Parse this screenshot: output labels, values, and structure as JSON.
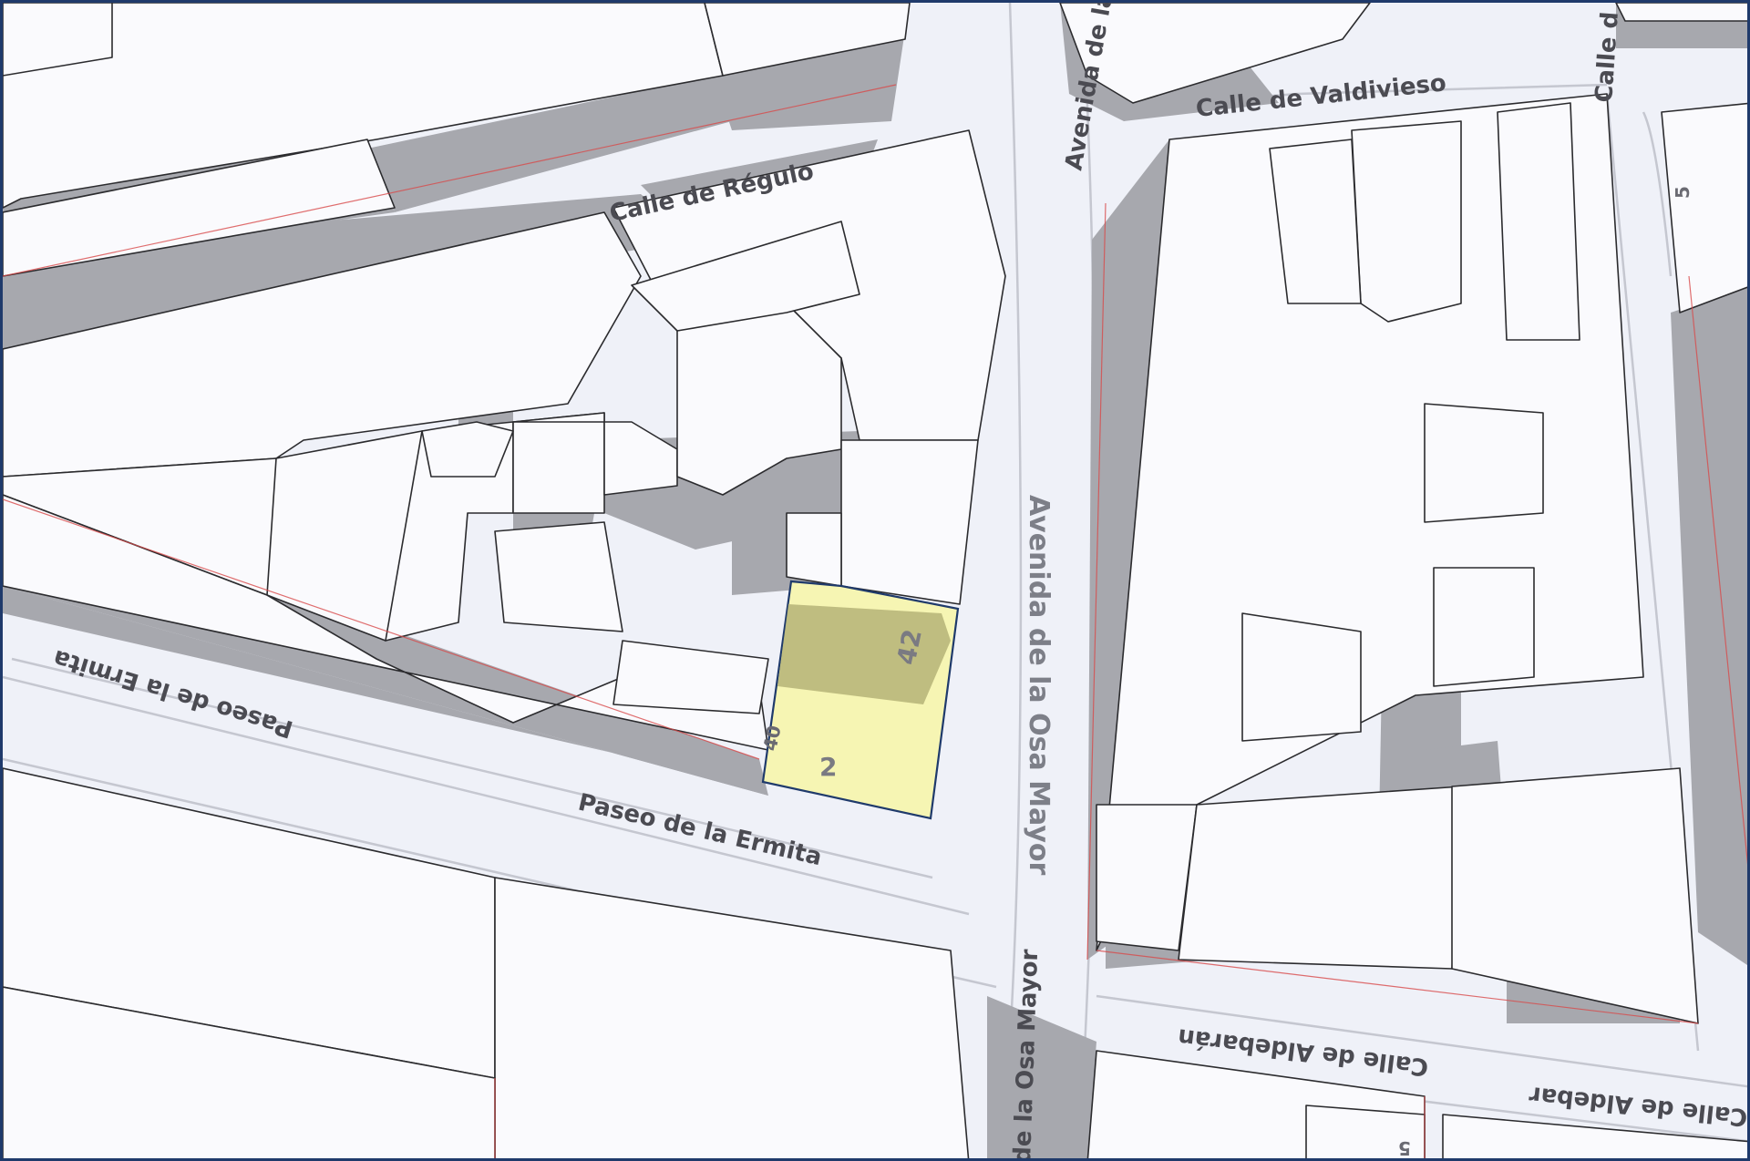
{
  "map": {
    "streets": [
      {
        "id": "paseo-ermita-upper",
        "label": "Paseo de la Ermita"
      },
      {
        "id": "paseo-ermita-lower",
        "label": "Paseo de la Ermita"
      },
      {
        "id": "osa-mayor-main",
        "label": "Avenida de la Osa Mayor"
      },
      {
        "id": "osa-mayor-top",
        "label": "Avenida de la"
      },
      {
        "id": "osa-mayor-bottom",
        "label": "de la Osa Mayor"
      },
      {
        "id": "valdivieso",
        "label": "Calle de Valdivieso"
      },
      {
        "id": "calle-top-right",
        "label": "Calle d"
      },
      {
        "id": "regulo",
        "label": "Calle de Régulo"
      },
      {
        "id": "aldebaran-1",
        "label": "Calle de Aldebarán"
      },
      {
        "id": "aldebaran-2",
        "label": "Calle de Aldebar"
      }
    ],
    "parcel": {
      "numbers": [
        "42",
        "2"
      ],
      "highlight_color": "#f6f5b3",
      "outline_color": "#1f3a6b"
    },
    "house_numbers": [
      "5",
      "5",
      "40"
    ],
    "colors": {
      "background": "#eff1f8",
      "building_roof": "#fafafd",
      "building_shadow": "#a7a8ae",
      "cadastral_line": "#d84a4a",
      "frame": "#1f3a6b"
    }
  }
}
